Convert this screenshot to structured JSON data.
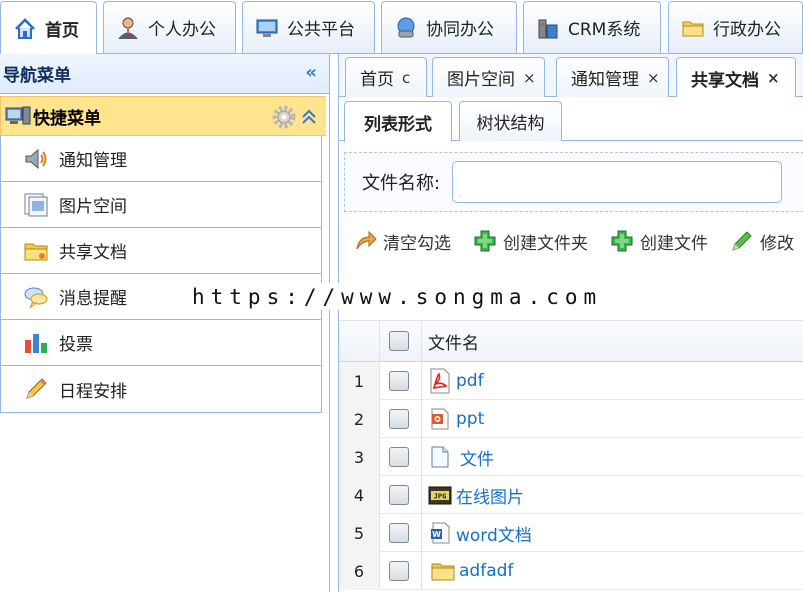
{
  "top_tabs": [
    {
      "label": "首页",
      "icon": "home-icon"
    },
    {
      "label": "个人办公",
      "icon": "person-icon"
    },
    {
      "label": "公共平台",
      "icon": "monitor-icon"
    },
    {
      "label": "协同办公",
      "icon": "workstation-icon"
    },
    {
      "label": "CRM系统",
      "icon": "building-icon"
    },
    {
      "label": "行政办公",
      "icon": "folder-icon"
    }
  ],
  "nav": {
    "title": "导航菜单",
    "quick_menu_title": "快捷菜单",
    "items": [
      {
        "label": "通知管理",
        "icon": "speaker-icon"
      },
      {
        "label": "图片空间",
        "icon": "picture-icon"
      },
      {
        "label": "共享文档",
        "icon": "shared-folder-icon"
      },
      {
        "label": "消息提醒",
        "icon": "chat-bubble-icon"
      },
      {
        "label": "投票",
        "icon": "bar-chart-icon"
      },
      {
        "label": "日程安排",
        "icon": "pencil-icon"
      }
    ]
  },
  "content_tabs": [
    {
      "label": "首页",
      "close": "c"
    },
    {
      "label": "图片空间",
      "close": "×"
    },
    {
      "label": "通知管理",
      "close": "×"
    },
    {
      "label": "共享文档",
      "close": "×"
    }
  ],
  "view_tabs": [
    "列表形式",
    "树状结构"
  ],
  "search": {
    "label": "文件名称:",
    "value": ""
  },
  "toolbar": {
    "clear": "清空勾选",
    "new_folder": "创建文件夹",
    "new_file": "创建文件",
    "edit": "修改"
  },
  "watermark": "https://www.songma.com",
  "grid": {
    "header": "文件名",
    "rows": [
      {
        "num": "1",
        "name": "pdf",
        "icon": "pdf-icon"
      },
      {
        "num": "2",
        "name": "ppt",
        "icon": "ppt-icon"
      },
      {
        "num": "3",
        "name": "文件",
        "icon": "document-icon"
      },
      {
        "num": "4",
        "name": "在线图片",
        "icon": "jpg-icon"
      },
      {
        "num": "5",
        "name": "word文档",
        "icon": "word-icon"
      },
      {
        "num": "6",
        "name": "adfadf",
        "icon": "folder-icon"
      }
    ]
  },
  "colors": {
    "border": "#95b8e7",
    "link": "#1570c9",
    "quick_menu_bg": "#ffe48d"
  }
}
